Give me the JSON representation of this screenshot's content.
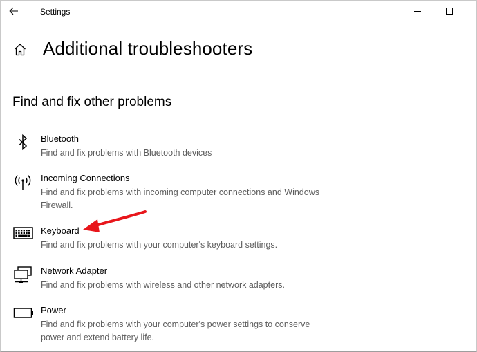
{
  "window": {
    "title": "Settings"
  },
  "page": {
    "title": "Additional troubleshooters",
    "section_title": "Find and fix other problems"
  },
  "icons": {
    "back": "back-arrow-icon",
    "home": "home-icon",
    "minimize": "minimize-icon",
    "maximize": "maximize-icon"
  },
  "colors": {
    "annotation_arrow": "#e8161b",
    "description_text": "#5d5d5d"
  },
  "troubleshooters": [
    {
      "name": "Bluetooth",
      "description": "Find and fix problems with Bluetooth devices",
      "icon": "bluetooth-icon"
    },
    {
      "name": "Incoming Connections",
      "description": "Find and fix problems with incoming computer connections and Windows Firewall.",
      "icon": "antenna-icon"
    },
    {
      "name": "Keyboard",
      "description": "Find and fix problems with your computer's keyboard settings.",
      "icon": "keyboard-icon"
    },
    {
      "name": "Network Adapter",
      "description": "Find and fix problems with wireless and other network adapters.",
      "icon": "network-adapter-icon"
    },
    {
      "name": "Power",
      "description": "Find and fix problems with your computer's power settings to conserve power and extend battery life.",
      "icon": "battery-icon"
    }
  ]
}
